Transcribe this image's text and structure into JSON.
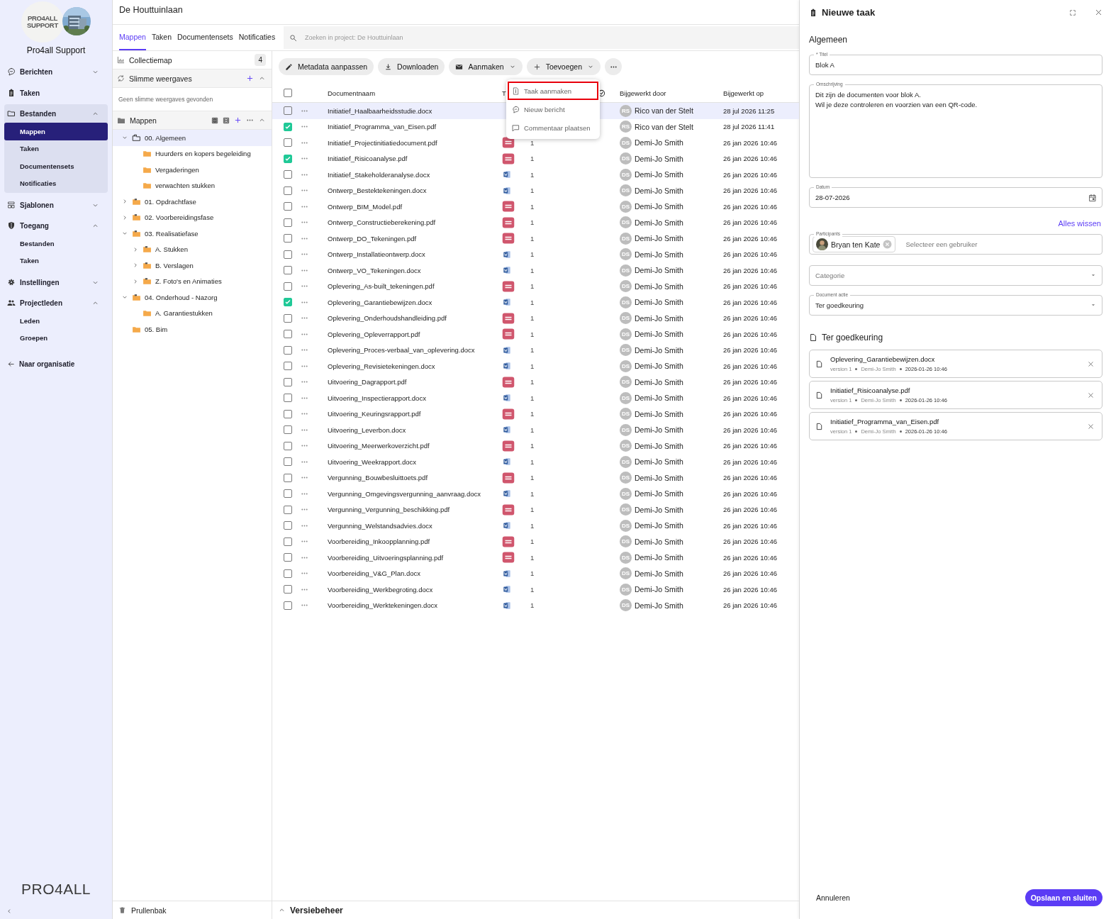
{
  "sidebar": {
    "logo": {
      "line1": "PRO4ALL",
      "line2": "SUPPORT"
    },
    "org_name": "Pro4all Support",
    "items": [
      {
        "label": "Berichten",
        "expanded": false
      },
      {
        "label": "Taken"
      },
      {
        "label": "Bestanden",
        "expanded": true,
        "children": [
          {
            "label": "Mappen",
            "selected": true
          },
          {
            "label": "Taken",
            "selected": false
          },
          {
            "label": "Documentensets",
            "selected": false
          },
          {
            "label": "Notificaties",
            "selected": false
          }
        ]
      },
      {
        "label": "Sjablonen",
        "expanded": false
      },
      {
        "label": "Toegang",
        "expanded": true,
        "children": [
          {
            "label": "Bestanden",
            "selected": false
          },
          {
            "label": "Taken",
            "selected": false
          }
        ]
      },
      {
        "label": "Instellingen",
        "expanded": false
      },
      {
        "label": "Projectleden",
        "expanded": true,
        "children": [
          {
            "label": "Leden",
            "selected": false
          },
          {
            "label": "Groepen",
            "selected": false
          }
        ]
      }
    ],
    "back_link": "Naar organisatie",
    "brand": "PRO4ALL"
  },
  "project_title": "De Houttuinlaan",
  "tabs": [
    {
      "label": "Mappen",
      "selected": true
    },
    {
      "label": "Taken",
      "selected": false
    },
    {
      "label": "Documentensets",
      "selected": false
    },
    {
      "label": "Notificaties",
      "selected": false
    }
  ],
  "search": {
    "placeholder": "Zoeken in project: De Houttuinlaan"
  },
  "folder_panel": {
    "collection": {
      "label": "Collectiemap",
      "count": "4"
    },
    "smart_views": {
      "label": "Slimme weergaves",
      "expanded": true,
      "empty_text": "Geen slimme weergaves gevonden"
    },
    "folders_header": {
      "label": "Mappen",
      "expanded": true
    },
    "tree": [
      {
        "label": "00. Algemeen",
        "expanded": true,
        "selected": true,
        "children": [
          {
            "label": "Huurders en kopers begeleiding",
            "selected": false
          },
          {
            "label": "Vergaderingen",
            "selected": false
          },
          {
            "label": "verwachten stukken",
            "selected": false
          }
        ]
      },
      {
        "label": "01. Opdrachtfase",
        "expanded": false,
        "selected": false
      },
      {
        "label": "02. Voorbereidingsfase",
        "expanded": false,
        "selected": false
      },
      {
        "label": "03. Realisatiefase",
        "expanded": true,
        "selected": false,
        "children": [
          {
            "label": "A. Stukken",
            "expanded": false,
            "selected": false
          },
          {
            "label": "B. Verslagen",
            "expanded": false,
            "selected": false
          },
          {
            "label": "Z. Foto's en Animaties",
            "expanded": false,
            "selected": false
          }
        ]
      },
      {
        "label": "04. Onderhoud - Nazorg",
        "expanded": true,
        "selected": false,
        "children": [
          {
            "label": "A. Garantiestukken",
            "selected": false
          }
        ]
      },
      {
        "label": "05. Bim",
        "selected": false
      }
    ],
    "trash": "Prullenbak"
  },
  "toolbar": [
    {
      "label": "Metadata aanpassen",
      "kind": "edit"
    },
    {
      "label": "Downloaden",
      "kind": "download"
    },
    {
      "label": "Aanmaken",
      "kind": "mail"
    },
    {
      "label": "Toevoegen",
      "kind": "add"
    }
  ],
  "menu": [
    {
      "label": "Taak aanmaken",
      "highlighted": true
    },
    {
      "label": "Nieuw bericht",
      "highlighted": false
    },
    {
      "label": "Commentaar plaatsen",
      "highlighted": false
    }
  ],
  "table": {
    "all_checked": false,
    "columns": {
      "name": "Documentnaam",
      "column_3": "T",
      "updated_by": "Bijgewerkt door",
      "updated_on": "Bijgewerkt op"
    },
    "rows": [
      {
        "name": "Initiatief_Haalbaarheidsstudie.docx",
        "initials": "RS",
        "by": "Rico van der Stelt",
        "date": "28 jul 2026 11:25",
        "checked": false,
        "highlighted": true
      },
      {
        "name": "Initiatief_Programma_van_Eisen.pdf",
        "initials": "RS",
        "by": "Rico van der Stelt",
        "date": "28 jul 2026 11:41",
        "checked": true,
        "highlighted": false
      },
      {
        "name": "Initiatief_Projectinitiatiedocument.pdf",
        "kind": "pdf",
        "version": "1",
        "initials": "DS",
        "by": "Demi-Jo Smith",
        "date": "26 jan 2026 10:46",
        "checked": false,
        "highlighted": false
      },
      {
        "name": "Initiatief_Risicoanalyse.pdf",
        "kind": "pdf",
        "version": "1",
        "initials": "DS",
        "by": "Demi-Jo Smith",
        "date": "26 jan 2026 10:46",
        "checked": true,
        "highlighted": false
      },
      {
        "name": "Initiatief_Stakeholderanalyse.docx",
        "kind": "docx",
        "version": "1",
        "initials": "DS",
        "by": "Demi-Jo Smith",
        "date": "26 jan 2026 10:46",
        "checked": false,
        "highlighted": false
      },
      {
        "name": "Ontwerp_Bestektekeningen.docx",
        "kind": "docx",
        "version": "1",
        "initials": "DS",
        "by": "Demi-Jo Smith",
        "date": "26 jan 2026 10:46",
        "checked": false,
        "highlighted": false
      },
      {
        "name": "Ontwerp_BIM_Model.pdf",
        "kind": "pdf",
        "version": "1",
        "initials": "DS",
        "by": "Demi-Jo Smith",
        "date": "26 jan 2026 10:46",
        "checked": false,
        "highlighted": false
      },
      {
        "name": "Ontwerp_Constructieberekening.pdf",
        "kind": "pdf",
        "version": "1",
        "initials": "DS",
        "by": "Demi-Jo Smith",
        "date": "26 jan 2026 10:46",
        "checked": false,
        "highlighted": false
      },
      {
        "name": "Ontwerp_DO_Tekeningen.pdf",
        "kind": "pdf",
        "version": "1",
        "initials": "DS",
        "by": "Demi-Jo Smith",
        "date": "26 jan 2026 10:46",
        "checked": false,
        "highlighted": false
      },
      {
        "name": "Ontwerp_Installatieontwerp.docx",
        "kind": "docx",
        "version": "1",
        "initials": "DS",
        "by": "Demi-Jo Smith",
        "date": "26 jan 2026 10:46",
        "checked": false,
        "highlighted": false
      },
      {
        "name": "Ontwerp_VO_Tekeningen.docx",
        "kind": "docx",
        "version": "1",
        "initials": "DS",
        "by": "Demi-Jo Smith",
        "date": "26 jan 2026 10:46",
        "checked": false,
        "highlighted": false
      },
      {
        "name": "Oplevering_As-built_tekeningen.pdf",
        "kind": "pdf",
        "version": "1",
        "initials": "DS",
        "by": "Demi-Jo Smith",
        "date": "26 jan 2026 10:46",
        "checked": false,
        "highlighted": false
      },
      {
        "name": "Oplevering_Garantiebewijzen.docx",
        "kind": "docx",
        "version": "1",
        "initials": "DS",
        "by": "Demi-Jo Smith",
        "date": "26 jan 2026 10:46",
        "checked": true,
        "highlighted": false
      },
      {
        "name": "Oplevering_Onderhoudshandleiding.pdf",
        "kind": "pdf",
        "version": "1",
        "initials": "DS",
        "by": "Demi-Jo Smith",
        "date": "26 jan 2026 10:46",
        "checked": false,
        "highlighted": false
      },
      {
        "name": "Oplevering_Opleverrapport.pdf",
        "kind": "pdf",
        "version": "1",
        "initials": "DS",
        "by": "Demi-Jo Smith",
        "date": "26 jan 2026 10:46",
        "checked": false,
        "highlighted": false
      },
      {
        "name": "Oplevering_Proces-verbaal_van_oplevering.docx",
        "kind": "docx",
        "version": "1",
        "initials": "DS",
        "by": "Demi-Jo Smith",
        "date": "26 jan 2026 10:46",
        "checked": false,
        "highlighted": false
      },
      {
        "name": "Oplevering_Revisietekeningen.docx",
        "kind": "docx",
        "version": "1",
        "initials": "DS",
        "by": "Demi-Jo Smith",
        "date": "26 jan 2026 10:46",
        "checked": false,
        "highlighted": false
      },
      {
        "name": "Uitvoering_Dagrapport.pdf",
        "kind": "pdf",
        "version": "1",
        "initials": "DS",
        "by": "Demi-Jo Smith",
        "date": "26 jan 2026 10:46",
        "checked": false,
        "highlighted": false
      },
      {
        "name": "Uitvoering_Inspectierapport.docx",
        "kind": "docx",
        "version": "1",
        "initials": "DS",
        "by": "Demi-Jo Smith",
        "date": "26 jan 2026 10:46",
        "checked": false,
        "highlighted": false
      },
      {
        "name": "Uitvoering_Keuringsrapport.pdf",
        "kind": "pdf",
        "version": "1",
        "initials": "DS",
        "by": "Demi-Jo Smith",
        "date": "26 jan 2026 10:46",
        "checked": false,
        "highlighted": false
      },
      {
        "name": "Uitvoering_Leverbon.docx",
        "kind": "docx",
        "version": "1",
        "initials": "DS",
        "by": "Demi-Jo Smith",
        "date": "26 jan 2026 10:46",
        "checked": false,
        "highlighted": false
      },
      {
        "name": "Uitvoering_Meerwerkoverzicht.pdf",
        "kind": "pdf",
        "version": "1",
        "initials": "DS",
        "by": "Demi-Jo Smith",
        "date": "26 jan 2026 10:46",
        "checked": false,
        "highlighted": false
      },
      {
        "name": "Uitvoering_Weekrapport.docx",
        "kind": "docx",
        "version": "1",
        "initials": "DS",
        "by": "Demi-Jo Smith",
        "date": "26 jan 2026 10:46",
        "checked": false,
        "highlighted": false
      },
      {
        "name": "Vergunning_Bouwbesluittoets.pdf",
        "kind": "pdf",
        "version": "1",
        "initials": "DS",
        "by": "Demi-Jo Smith",
        "date": "26 jan 2026 10:46",
        "checked": false,
        "highlighted": false
      },
      {
        "name": "Vergunning_Omgevingsvergunning_aanvraag.docx",
        "kind": "docx",
        "version": "1",
        "initials": "DS",
        "by": "Demi-Jo Smith",
        "date": "26 jan 2026 10:46",
        "checked": false,
        "highlighted": false
      },
      {
        "name": "Vergunning_Vergunning_beschikking.pdf",
        "kind": "pdf",
        "version": "1",
        "initials": "DS",
        "by": "Demi-Jo Smith",
        "date": "26 jan 2026 10:46",
        "checked": false,
        "highlighted": false
      },
      {
        "name": "Vergunning_Welstandsadvies.docx",
        "kind": "docx",
        "version": "1",
        "initials": "DS",
        "by": "Demi-Jo Smith",
        "date": "26 jan 2026 10:46",
        "checked": false,
        "highlighted": false
      },
      {
        "name": "Voorbereiding_Inkoopplanning.pdf",
        "kind": "pdf",
        "version": "1",
        "initials": "DS",
        "by": "Demi-Jo Smith",
        "date": "26 jan 2026 10:46",
        "checked": false,
        "highlighted": false
      },
      {
        "name": "Voorbereiding_Uitvoeringsplanning.pdf",
        "kind": "pdf",
        "version": "1",
        "initials": "DS",
        "by": "Demi-Jo Smith",
        "date": "26 jan 2026 10:46",
        "checked": false,
        "highlighted": false
      },
      {
        "name": "Voorbereiding_V&G_Plan.docx",
        "kind": "docx",
        "version": "1",
        "initials": "DS",
        "by": "Demi-Jo Smith",
        "date": "26 jan 2026 10:46",
        "checked": false,
        "highlighted": false
      },
      {
        "name": "Voorbereiding_Werkbegroting.docx",
        "kind": "docx",
        "version": "1",
        "initials": "DS",
        "by": "Demi-Jo Smith",
        "date": "26 jan 2026 10:46",
        "checked": false,
        "highlighted": false
      },
      {
        "name": "Voorbereiding_Werktekeningen.docx",
        "kind": "docx",
        "version": "1",
        "initials": "DS",
        "by": "Demi-Jo Smith",
        "date": "26 jan 2026 10:46",
        "checked": false,
        "highlighted": false
      }
    ]
  },
  "version_panel": {
    "label": "Versiebeheer",
    "expanded": false
  },
  "task_panel": {
    "title": "Nieuwe taak",
    "section": "Algemeen",
    "title_field": {
      "label": "* Titel",
      "value": "Blok A"
    },
    "description": {
      "label": "Omschrijving",
      "value": "Dit zijn de documenten voor blok A.\nWil je deze controleren en voorzien van een QR-code."
    },
    "date": {
      "label": "Datum",
      "value": "28-07-2026"
    },
    "clear_all": "Alles wissen",
    "participants": {
      "label": "Participants",
      "chips": [
        "Bryan ten Kate"
      ],
      "placeholder": "Selecteer een gebruiker"
    },
    "category": {
      "placeholder": "Categorie"
    },
    "document_action": {
      "label": "Document actie",
      "value": "Ter goedkeuring"
    },
    "documents_title": "Ter goedkeuring",
    "documents": [
      {
        "name": "Oplevering_Garantiebewijzen.docx",
        "version": "version 1",
        "author": "Demi-Jo Smith",
        "date": "2026-01-26 10:46"
      },
      {
        "name": "Initiatief_Risicoanalyse.pdf",
        "version": "version 1",
        "author": "Demi-Jo Smith",
        "date": "2026-01-26 10:46"
      },
      {
        "name": "Initiatief_Programma_van_Eisen.pdf",
        "version": "version 1",
        "author": "Demi-Jo Smith",
        "date": "2026-01-26 10:46"
      }
    ],
    "cancel": "Annuleren",
    "save": "Opslaan en sluiten"
  }
}
